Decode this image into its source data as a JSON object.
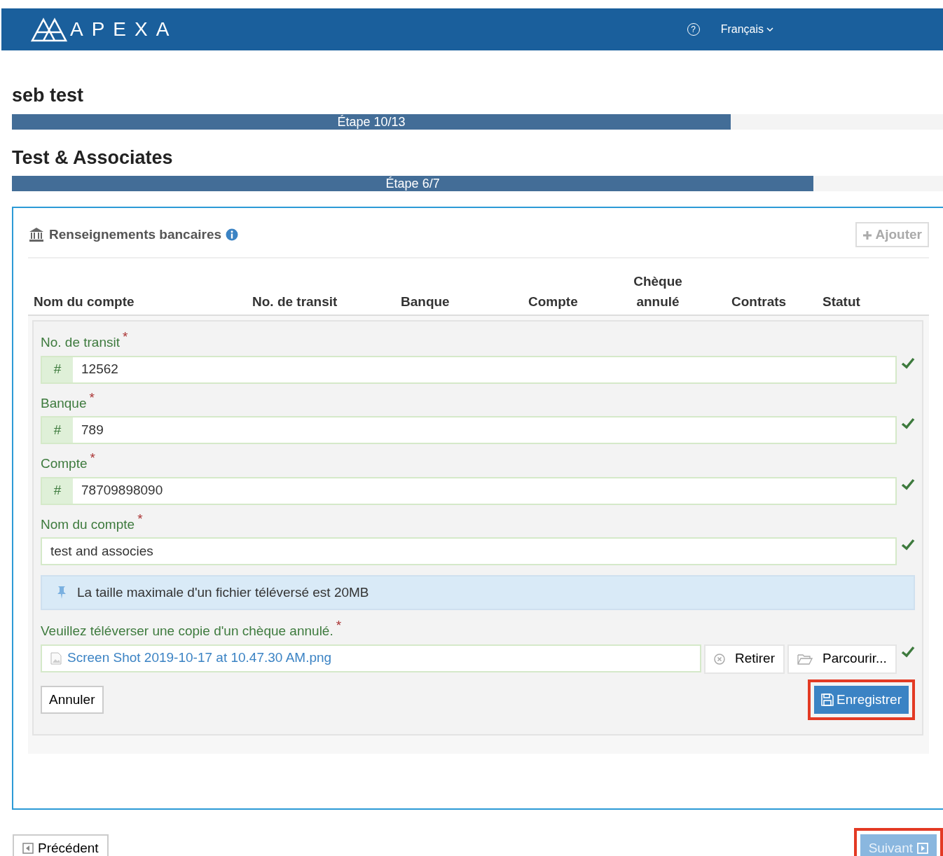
{
  "navbar": {
    "logo": "APEXA",
    "help": "?",
    "language": "Français"
  },
  "progress": [
    {
      "title": "seb test",
      "label": "Étape 10/13",
      "level": 0.772
    },
    {
      "title": "Test & Associates",
      "label": "Étape 6/7",
      "level": 0.861
    }
  ],
  "panel": {
    "title": "Renseignements bancaires",
    "add_button": "Ajouter",
    "columns": [
      "Nom du compte",
      "No. de transit",
      "Banque",
      "Compte",
      "Chèque annulé",
      "Contrats",
      "Statut"
    ],
    "fields": [
      {
        "kind": "prefixed",
        "label": "No. de transit",
        "required_mark": "*",
        "prefix": "#",
        "value": "12562",
        "valid": true
      },
      {
        "kind": "prefixed",
        "label": "Banque",
        "required_mark": "*",
        "prefix": "#",
        "value": "789",
        "valid": true
      },
      {
        "kind": "prefixed",
        "label": "Compte",
        "required_mark": "*",
        "prefix": "#",
        "value": "78709898090",
        "valid": true
      },
      {
        "kind": "plain",
        "label": "Nom du compte",
        "required_mark": "*",
        "value": "test and associes",
        "valid": true
      }
    ],
    "notice": "La taille maximale d'un fichier téléversé est 20MB",
    "upload": {
      "label": "Veuillez téléverser une copie d'un chèque annulé.",
      "required_mark": "*",
      "file": "Screen Shot 2019-10-17 at 10.47.30 AM.png",
      "remove": "Retirer",
      "browse": "Parcourir...",
      "valid": true
    },
    "cancel": "Annuler",
    "save": {
      "label": "Enregistrer",
      "highlighted": true
    }
  },
  "footer": {
    "previous": {
      "label": "Précédent"
    },
    "next": {
      "label": "Suivant",
      "disabled": true,
      "highlighted": true
    }
  }
}
